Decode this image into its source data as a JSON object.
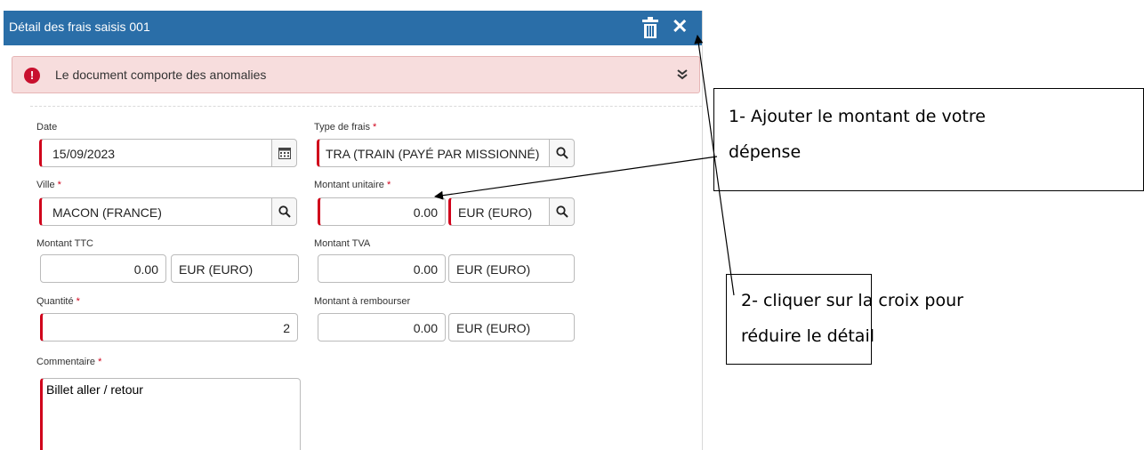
{
  "window": {
    "title": "Détail des frais saisis 001"
  },
  "icons": {
    "trash": "trash-icon",
    "close": "close-icon",
    "calendar": "calendar-icon",
    "search": "search-icon",
    "alert": "exclamation-icon",
    "expand": "double-chevron-down-icon"
  },
  "toolbar": {
    "close_label": "✕"
  },
  "alert": {
    "message": "Le document comporte des anomalies",
    "icon_text": "!",
    "expand_label": "⌄"
  },
  "form": {
    "date": {
      "label": "Date",
      "value": "15/09/2023"
    },
    "type_frais": {
      "label": "Type de frais",
      "value": "TRA (TRAIN (PAYÉ PAR MISSIONNÉ)"
    },
    "ville": {
      "label": "Ville",
      "value": "MACON (FRANCE)"
    },
    "montant_unitaire": {
      "label": "Montant unitaire",
      "value": "0.00",
      "currency": "EUR (EURO)"
    },
    "montant_ttc": {
      "label": "Montant TTC",
      "value": "0.00",
      "currency": "EUR (EURO)"
    },
    "montant_tva": {
      "label": "Montant TVA",
      "value": "0.00",
      "currency": "EUR (EURO)"
    },
    "quantite": {
      "label": "Quantité",
      "value": "2"
    },
    "montant_rembourser": {
      "label": "Montant à rembourser",
      "value": "0.00",
      "currency": "EUR (EURO)"
    },
    "commentaire": {
      "label": "Commentaire",
      "value": "Billet aller / retour"
    },
    "required_mark": "*"
  },
  "callouts": {
    "first": {
      "line1": "1- Ajouter le montant de votre",
      "line2": "dépense"
    },
    "second": {
      "line1": "2- cliquer sur la croix pour",
      "line2": "réduire le détail"
    }
  },
  "colors": {
    "titlebar": "#2a6ea8",
    "required": "#d0021b",
    "alert_bg": "#f7dddd"
  }
}
